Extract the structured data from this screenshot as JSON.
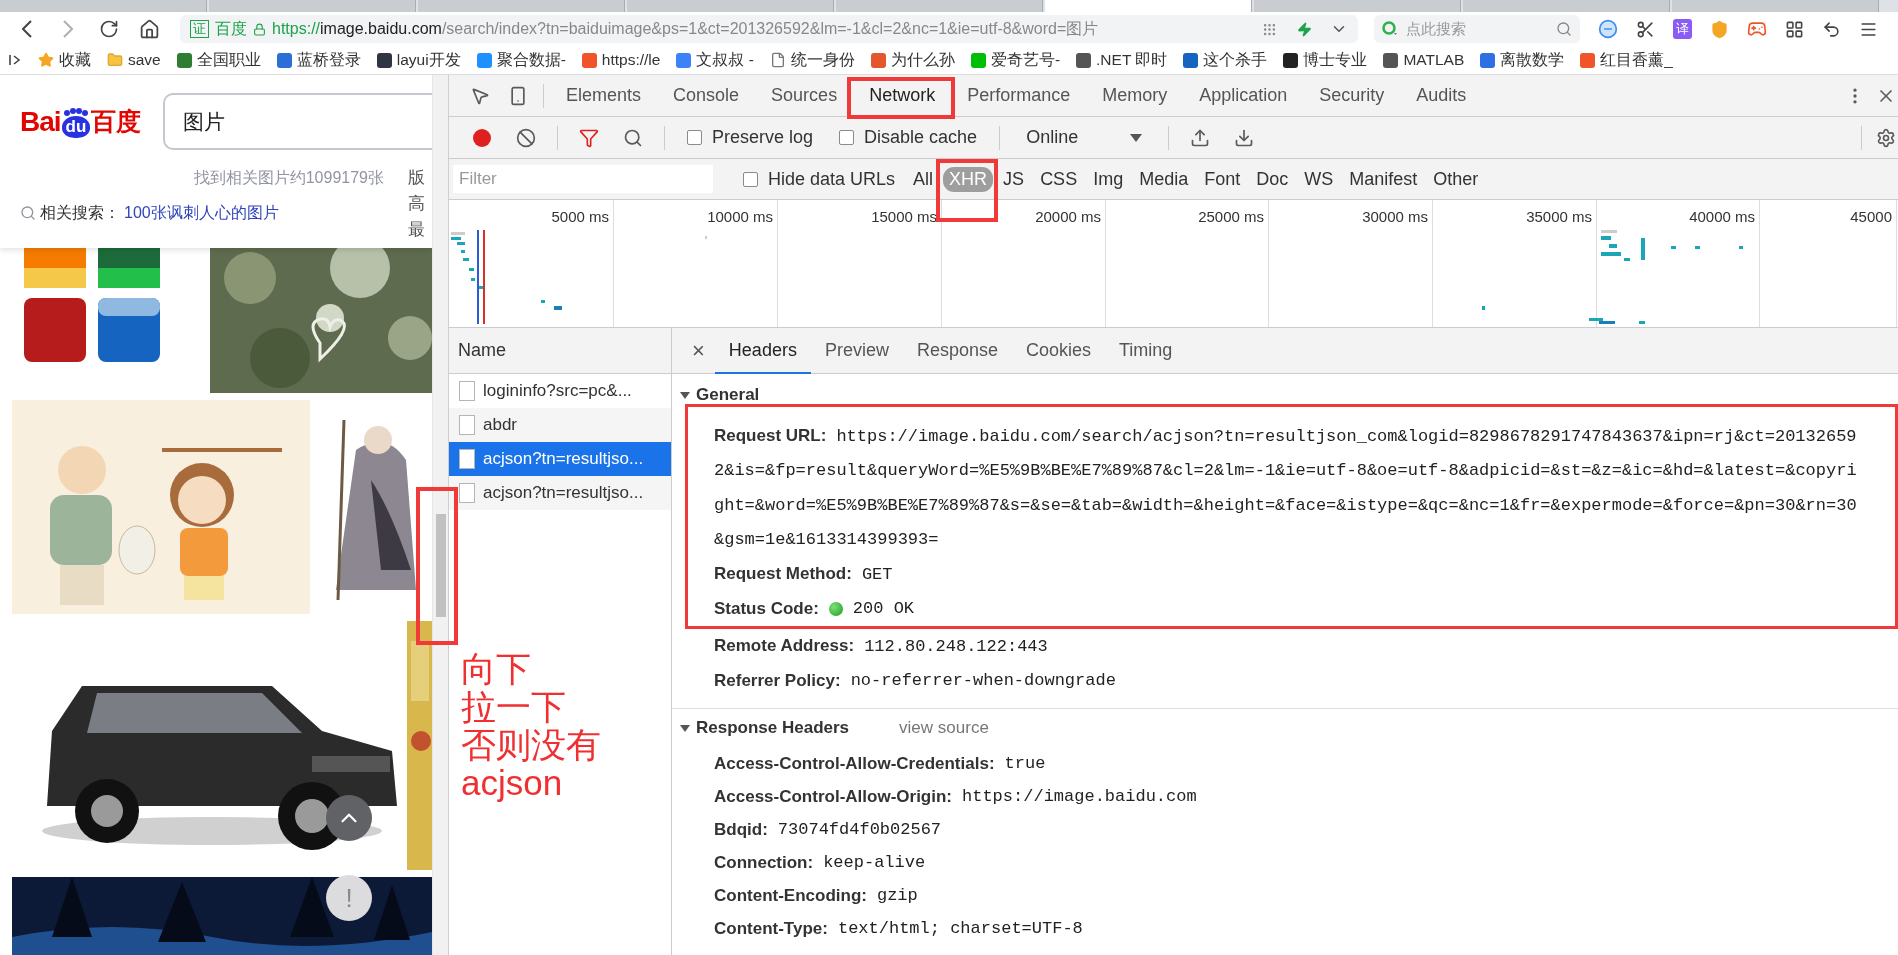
{
  "browser_tabs": [
    {
      "selected": false
    },
    {
      "selected": false
    },
    {
      "selected": false
    },
    {
      "selected": false
    },
    {
      "selected": false
    },
    {
      "selected": true
    },
    {
      "selected": false
    },
    {
      "selected": false
    },
    {
      "selected": false
    }
  ],
  "address_bar": {
    "cert_badge": "证",
    "site_name": "百度",
    "url_scheme": "https://",
    "url_host": "image.baidu.com",
    "url_rest": "/search/index?tn=baiduimage&ps=1&ct=201326592&lm=-1&cl=2&nc=1&ie=utf-8&word=图片"
  },
  "search_box": {
    "placeholder": "点此搜索"
  },
  "translate_badge": "译",
  "bookmarks": [
    {
      "kind": "star",
      "label": "收藏"
    },
    {
      "kind": "folder",
      "label": "save"
    },
    {
      "kind": "site",
      "label": "全国职业",
      "color": "#2e7d32"
    },
    {
      "kind": "site",
      "label": "蓝桥登录",
      "color": "#2b6fd6"
    },
    {
      "kind": "site",
      "label": "layui开发",
      "color": "#2f3542"
    },
    {
      "kind": "site",
      "label": "聚合数据-",
      "color": "#1e90ff"
    },
    {
      "kind": "site",
      "label": "https://le",
      "color": "#f0552a"
    },
    {
      "kind": "site",
      "label": "文叔叔 -",
      "color": "#3b82f6"
    },
    {
      "kind": "page",
      "label": "统一身份"
    },
    {
      "kind": "site",
      "label": "为什么孙",
      "color": "#e4572e"
    },
    {
      "kind": "site",
      "label": "爱奇艺号-",
      "color": "#00be06"
    },
    {
      "kind": "site",
      "label": ".NET 即时",
      "color": "#555555"
    },
    {
      "kind": "site",
      "label": "这个杀手",
      "color": "#1565c0"
    },
    {
      "kind": "site",
      "label": "博士专业",
      "color": "#222222"
    },
    {
      "kind": "site",
      "label": "MATLAB",
      "color": "#555555"
    },
    {
      "kind": "site",
      "label": "离散数学",
      "color": "#2f6fe4"
    },
    {
      "kind": "site",
      "label": "红目香薰_",
      "color": "#f0552a"
    }
  ],
  "page": {
    "logo": {
      "left": "Bai",
      "paw": "du",
      "right": "百度"
    },
    "search_value": "图片",
    "result_count": "找到相关图片约1099179张",
    "side_filters": [
      "版",
      "高",
      "最"
    ],
    "related_label": "相关搜索：",
    "related_link": "100张讽刺人心的图片",
    "feedback_button": "!",
    "scrollbar": {
      "highlighted": true
    }
  },
  "devtools": {
    "tabs": [
      {
        "label": "Elements",
        "selected": false,
        "highlighted": false
      },
      {
        "label": "Console",
        "selected": false,
        "highlighted": false
      },
      {
        "label": "Sources",
        "selected": false,
        "highlighted": false
      },
      {
        "label": "Network",
        "selected": true,
        "highlighted": true
      },
      {
        "label": "Performance",
        "selected": false,
        "highlighted": false
      },
      {
        "label": "Memory",
        "selected": false,
        "highlighted": false
      },
      {
        "label": "Application",
        "selected": false,
        "highlighted": false
      },
      {
        "label": "Security",
        "selected": false,
        "highlighted": false
      },
      {
        "label": "Audits",
        "selected": false,
        "highlighted": false
      }
    ],
    "toolbar": {
      "recording": true,
      "filter_active": true,
      "preserve_log": {
        "label": "Preserve log",
        "checked": false
      },
      "disable_cache": {
        "label": "Disable cache",
        "checked": false
      },
      "throttling": "Online"
    },
    "filter": {
      "placeholder": "Filter",
      "hide_data_urls": {
        "label": "Hide data URLs",
        "checked": false
      },
      "types": [
        {
          "label": "All",
          "selected": false,
          "highlighted": false
        },
        {
          "label": "XHR",
          "selected": true,
          "highlighted": true
        },
        {
          "label": "JS",
          "selected": false,
          "highlighted": false
        },
        {
          "label": "CSS",
          "selected": false,
          "highlighted": false
        },
        {
          "label": "Img",
          "selected": false,
          "highlighted": false
        },
        {
          "label": "Media",
          "selected": false,
          "highlighted": false
        },
        {
          "label": "Font",
          "selected": false,
          "highlighted": false
        },
        {
          "label": "Doc",
          "selected": false,
          "highlighted": false
        },
        {
          "label": "WS",
          "selected": false,
          "highlighted": false
        },
        {
          "label": "Manifest",
          "selected": false,
          "highlighted": false
        },
        {
          "label": "Other",
          "selected": false,
          "highlighted": false
        }
      ]
    },
    "timeline": {
      "ticks": [
        "5000 ms",
        "10000 ms",
        "15000 ms",
        "20000 ms",
        "25000 ms",
        "30000 ms",
        "35000 ms",
        "40000 ms",
        "45000"
      ]
    },
    "requests": {
      "header": "Name",
      "rows": [
        {
          "name": "logininfo?src=pc&...",
          "selected": false
        },
        {
          "name": "abdr",
          "selected": false
        },
        {
          "name": "acjson?tn=resultjso...",
          "selected": true
        },
        {
          "name": "acjson?tn=resultjso...",
          "selected": false
        }
      ]
    },
    "note": [
      "向下",
      "拉一下",
      "否则没有",
      "acjson"
    ],
    "details": {
      "close": "×",
      "tabs": [
        {
          "label": "Headers",
          "selected": true
        },
        {
          "label": "Preview",
          "selected": false
        },
        {
          "label": "Response",
          "selected": false
        },
        {
          "label": "Cookies",
          "selected": false
        },
        {
          "label": "Timing",
          "selected": false
        }
      ],
      "general": {
        "title": "General",
        "expanded": true,
        "rows": [
          {
            "label": "Request URL:",
            "highlighted": true,
            "kind": "text",
            "lines": [
              "https://image.baidu.com/search/acjson?tn=resultjson_com&logid=8298678291747843637&ipn=rj&ct=20132659",
              "2&is=&fp=result&queryWord=%E5%9B%BE%E7%89%87&cl=2&lm=-1&ie=utf-8&oe=utf-8&adpicid=&st=&z=&ic=&hd=&latest=&copyri",
              "ght=&word=%E5%9B%BE%E7%89%87&s=&se=&tab=&width=&height=&face=&istype=&qc=&nc=1&fr=&expermode=&force=&pn=30&rn=30",
              "&gsm=1e&1613314399393="
            ]
          },
          {
            "label": "Request Method:",
            "highlighted": true,
            "kind": "text",
            "lines": [
              "GET"
            ]
          },
          {
            "label": "Status Code:",
            "highlighted": true,
            "kind": "status",
            "lines": [
              "200 OK"
            ]
          },
          {
            "label": "Remote Address:",
            "highlighted": false,
            "kind": "text",
            "lines": [
              "112.80.248.122:443"
            ]
          },
          {
            "label": "Referrer Policy:",
            "highlighted": false,
            "kind": "text",
            "lines": [
              "no-referrer-when-downgrade"
            ]
          }
        ]
      },
      "response_headers": {
        "title": "Response Headers",
        "expanded": true,
        "link": "view source",
        "rows": [
          {
            "label": "Access-Control-Allow-Credentials:",
            "value": "true"
          },
          {
            "label": "Access-Control-Allow-Origin:",
            "value": "https://image.baidu.com"
          },
          {
            "label": "Bdqid:",
            "value": "73074fd4f0b02567"
          },
          {
            "label": "Connection:",
            "value": "keep-alive"
          },
          {
            "label": "Content-Encoding:",
            "value": "gzip"
          },
          {
            "label": "Content-Type:",
            "value": "text/html; charset=UTF-8"
          }
        ]
      }
    }
  }
}
